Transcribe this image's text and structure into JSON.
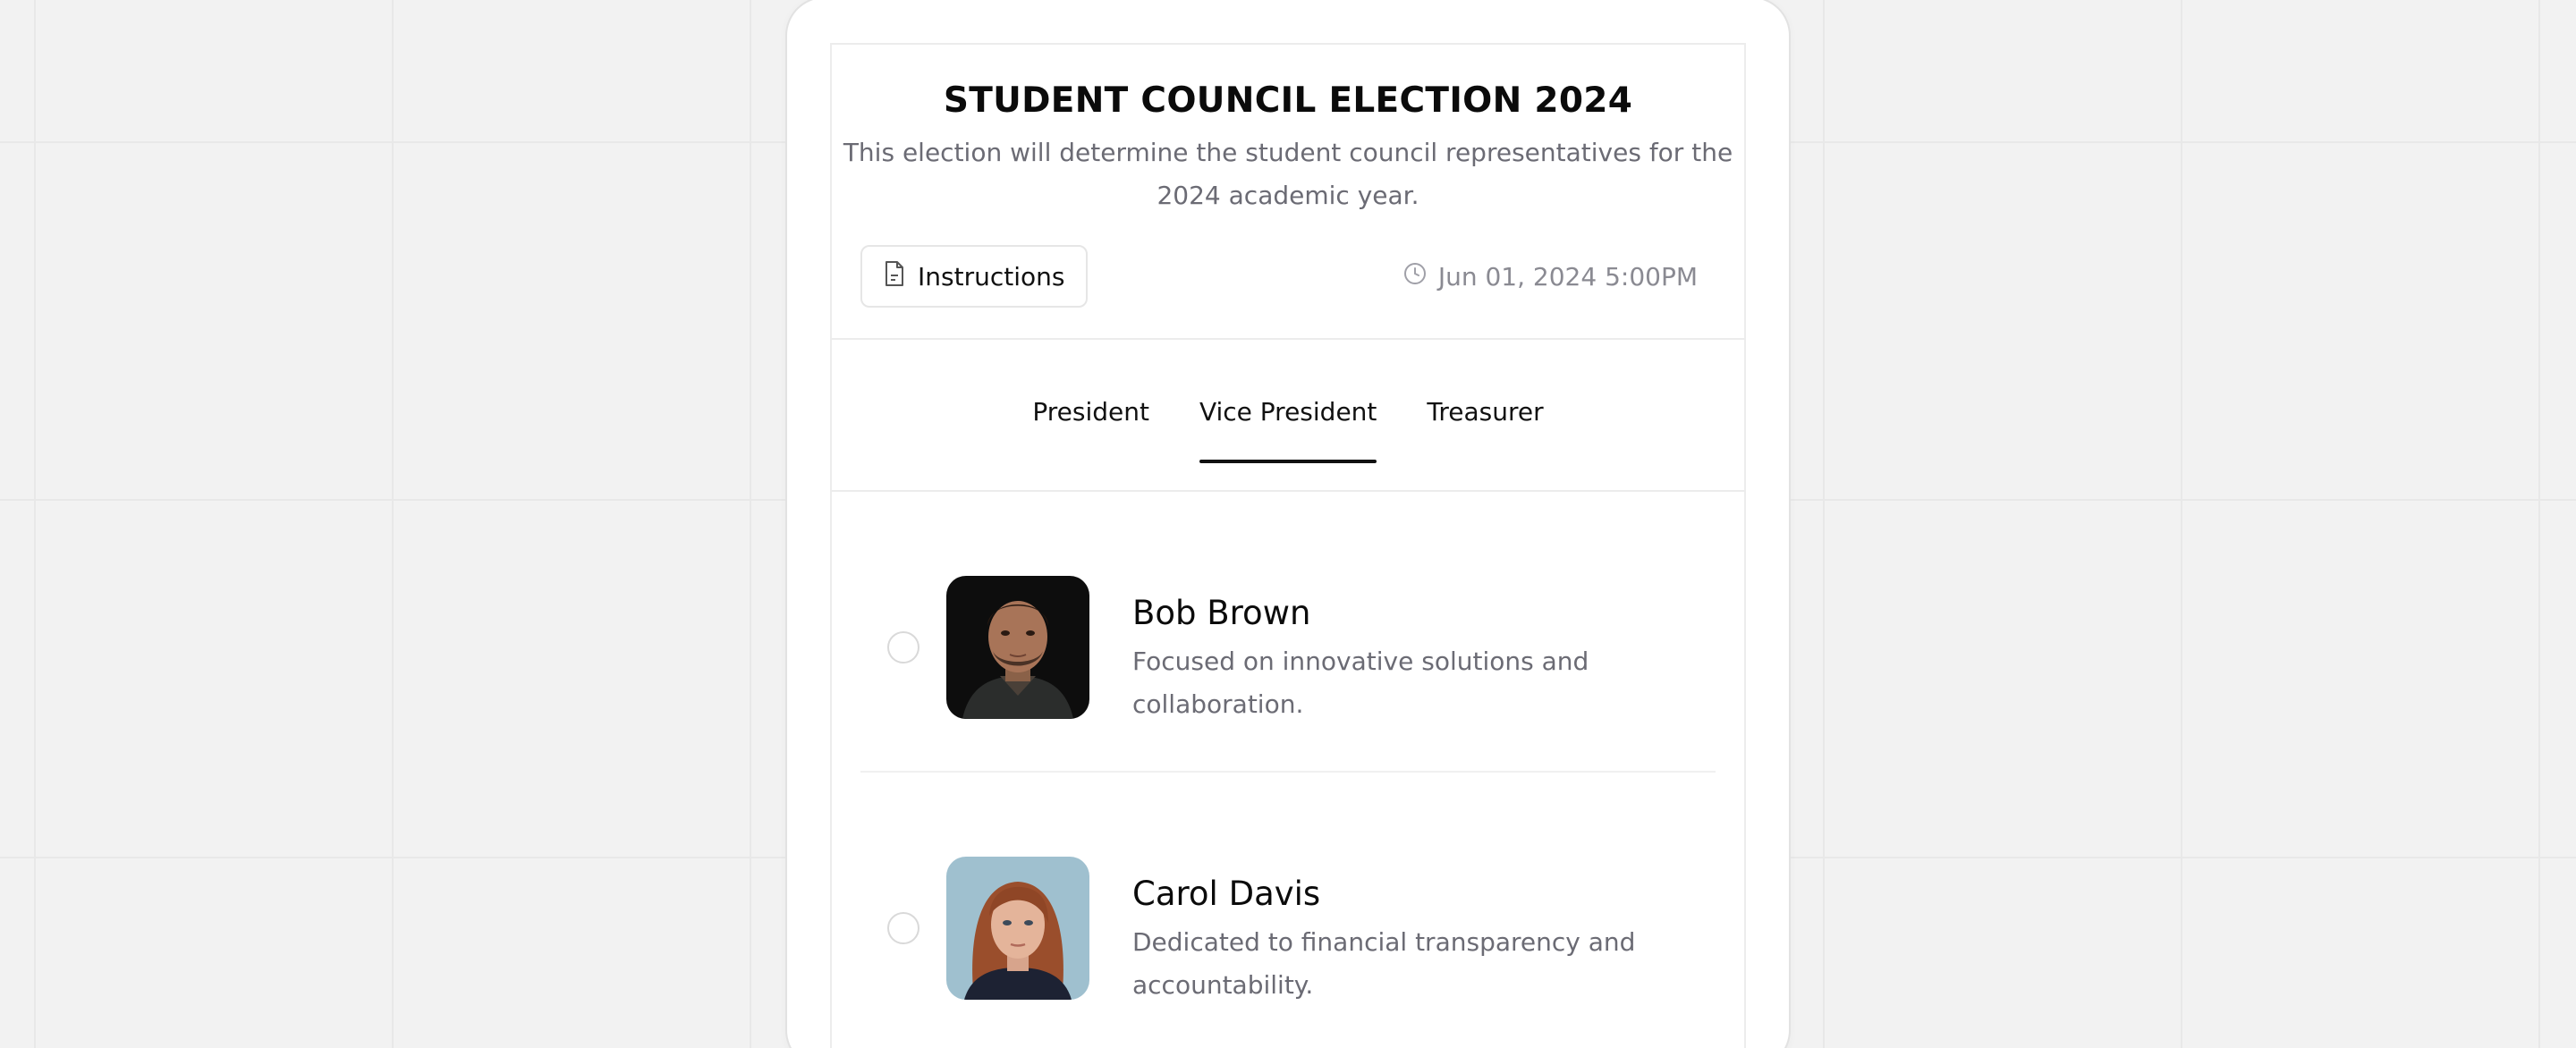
{
  "election": {
    "title": "STUDENT COUNCIL ELECTION 2024",
    "description": "This election will determine the student council representatives for the 2024 academic year.",
    "instructions_label": "Instructions",
    "deadline": "Jun 01, 2024 5:00PM"
  },
  "tabs": [
    {
      "label": "President",
      "active": false
    },
    {
      "label": "Vice President",
      "active": true
    },
    {
      "label": "Treasurer",
      "active": false
    }
  ],
  "candidates": [
    {
      "name": "Bob Brown",
      "bio": "Focused on innovative solutions and collaboration.",
      "selected": false
    },
    {
      "name": "Carol Davis",
      "bio": "Dedicated to financial transparency and accountability.",
      "selected": false
    }
  ],
  "icons": {
    "instructions": "document-icon",
    "deadline": "clock-icon"
  },
  "colors": {
    "background": "#f2f2f2",
    "card": "#ffffff",
    "text_primary": "#111111",
    "text_secondary": "#6b6b74",
    "active_tab_underline": "#111111"
  }
}
